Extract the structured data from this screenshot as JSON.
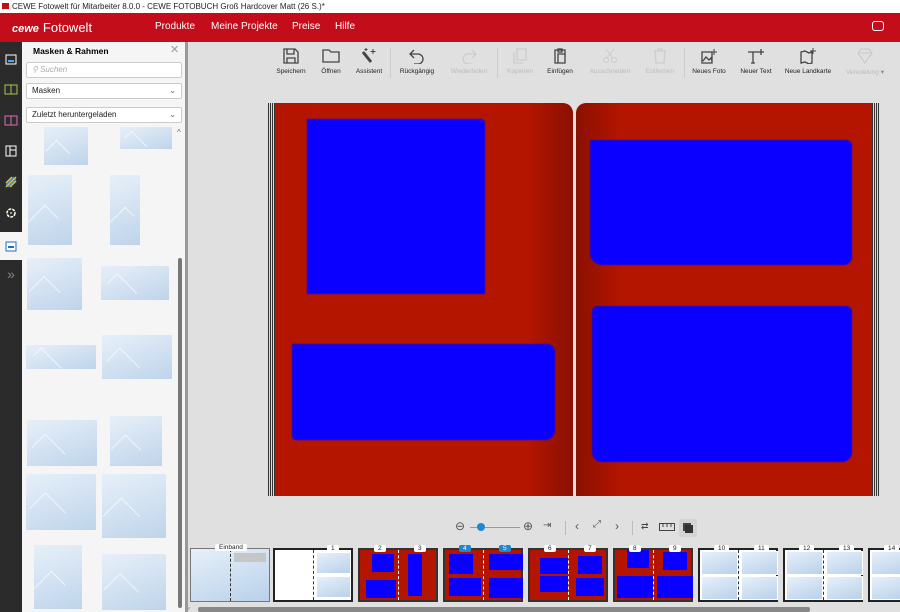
{
  "window": {
    "title": "CEWE Fotowelt für Mitarbeiter 8.0.0 - CEWE FOTOBUCH Groß Hardcover Matt (26 S.)*"
  },
  "header": {
    "brand_logo": "cewe",
    "brand_name": "Fotowelt",
    "nav": [
      "Produkte",
      "Meine Projekte",
      "Preise",
      "Hilfe"
    ],
    "accent": "#c30d1a"
  },
  "rail": {
    "icons": [
      "photos-icon",
      "book-icon",
      "pages-icon",
      "layout-icon",
      "background-icon",
      "clipart-icon",
      "masks-icon",
      "expand-icon"
    ]
  },
  "panel": {
    "title": "Masken & Rahmen",
    "search_placeholder": "Suchen",
    "category": "Masken",
    "sort": "Zuletzt heruntergeladen"
  },
  "toolbar": {
    "items": [
      {
        "label": "Speichern",
        "icon": "save-icon",
        "enabled": true
      },
      {
        "label": "Öffnen",
        "icon": "folder-icon",
        "enabled": true
      },
      {
        "label": "Assistent",
        "icon": "magic-wand-icon",
        "enabled": true
      },
      {
        "label": "Rückgängig",
        "icon": "undo-icon",
        "enabled": true
      },
      {
        "label": "Wiederholen",
        "icon": "redo-icon",
        "enabled": false
      },
      {
        "label": "Kopieren",
        "icon": "copy-icon",
        "enabled": false
      },
      {
        "label": "Einfügen",
        "icon": "paste-icon",
        "enabled": true
      },
      {
        "label": "Ausschneiden",
        "icon": "scissors-icon",
        "enabled": false
      },
      {
        "label": "Entfernen",
        "icon": "trash-icon",
        "enabled": false
      },
      {
        "label": "Neues Foto",
        "icon": "add-photo-icon",
        "enabled": true
      },
      {
        "label": "Neuer Text",
        "icon": "add-text-icon",
        "enabled": true
      },
      {
        "label": "Neue Landkarte",
        "icon": "add-map-icon",
        "enabled": true
      },
      {
        "label": "Veredelung",
        "icon": "diamond-icon",
        "enabled": false
      }
    ]
  },
  "canvas": {
    "page_color": "#b31500",
    "mask_color": "#0a00ff"
  },
  "zoom": {
    "level": 0.1
  },
  "pages": [
    {
      "label": "Einband",
      "type": "cover"
    },
    {
      "label": "1",
      "type": "first"
    },
    {
      "label": "2|3",
      "labels": [
        "2",
        "3"
      ]
    },
    {
      "label": "4|5",
      "labels": [
        "4",
        "5"
      ],
      "selected": true
    },
    {
      "label": "6|7",
      "labels": [
        "6",
        "7"
      ]
    },
    {
      "label": "8|9",
      "labels": [
        "8",
        "9"
      ]
    },
    {
      "label": "10|11",
      "labels": [
        "10",
        "11"
      ],
      "empty": true
    },
    {
      "label": "12|13",
      "labels": [
        "12",
        "13"
      ],
      "empty": true
    },
    {
      "label": "14",
      "labels": [
        "14"
      ],
      "empty": true
    }
  ]
}
